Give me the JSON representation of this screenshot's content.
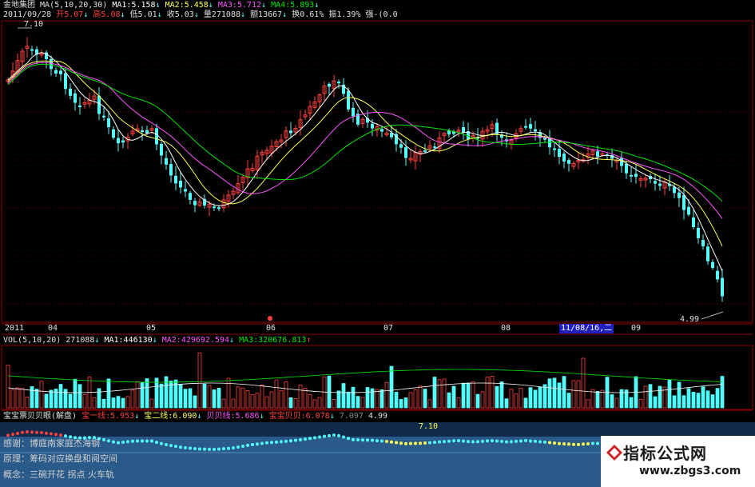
{
  "header": {
    "name": "金地集团",
    "ma_params": "MA(5,10,20,30)",
    "ma1": "MA1:5.158",
    "ma2": "MA2:5.458",
    "ma3": "MA3:5.712",
    "ma4": "MA4:5.893",
    "date": "2011/09/28",
    "open": "开5.07",
    "high": "高5.08",
    "low": "低5.01",
    "close": "收5.03",
    "vol": "量271088",
    "amount": "额13667",
    "turnover": "换0.61%",
    "amplitude": "振1.39%",
    "strength": "强-(0.0"
  },
  "price_marks": {
    "high": "7.10",
    "low": "4.99"
  },
  "time_axis": {
    "labels": [
      "2011",
      "04",
      "05",
      "06",
      "07",
      "08",
      "09"
    ],
    "cursor_date": "11/08/16,二"
  },
  "volume_header": {
    "params": "VOL(5,10,20)",
    "vol": "271088",
    "ma1": "MA1:446130",
    "ma2": "MA2:429692.594",
    "ma3": "MA3:320676.813"
  },
  "indicator_header": {
    "name": "宝宝票贝贝眼(解盘)",
    "line1": "宝一线:5.953",
    "line2": "宝二线:6.090",
    "line3": "贝贝线:5.686",
    "line4": "宝宝贝贝:6.078",
    "v1": "7.097",
    "v2": "4.99",
    "top_value": "7.10"
  },
  "notes": {
    "thanks": "感谢：博庭南家庭杰海钢",
    "principle": "原理：筹码对应换盘和阅空间",
    "concept": "概念：三碗开花   拐点   火车轨"
  },
  "watermark": {
    "title": "指标公式网",
    "url": "www.zbgs3.com"
  },
  "colors": {
    "up": "#ff4040",
    "down": "#54fcfc",
    "ma1": "#ffffff",
    "ma2": "#ffff54",
    "ma3": "#ff54ff",
    "ma4": "#00e600",
    "grid": "#8b0000"
  }
}
